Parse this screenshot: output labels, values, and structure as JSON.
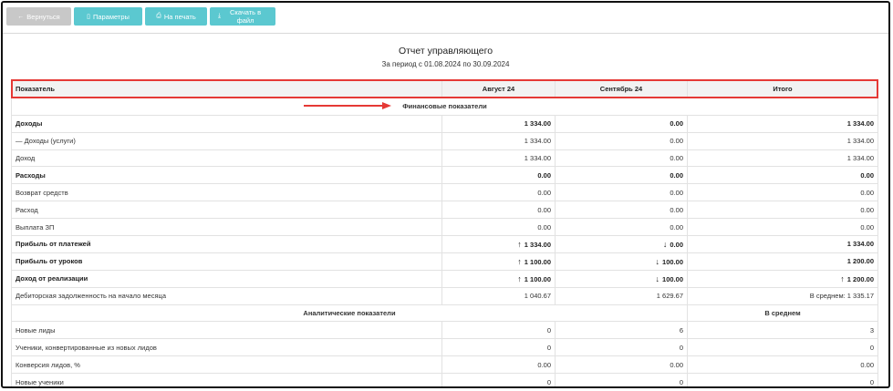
{
  "toolbar": {
    "back_label": "Вернуться",
    "params_label": "Параметры",
    "print_label": "На печать",
    "download_label": "Скачать в файл"
  },
  "report": {
    "title": "Отчет управляющего",
    "period": "За период с 01.08.2024 по 30.09.2024"
  },
  "table": {
    "headers": [
      "Показатель",
      "Август 24",
      "Сентябрь 24",
      "Итого"
    ],
    "sections": [
      {
        "title": "Финансовые показатели"
      },
      {
        "title": "Аналитические показатели",
        "side_title": "В среднем"
      }
    ],
    "financial_rows": [
      {
        "label": "Доходы",
        "bold": true,
        "aug": "1 334.00",
        "sep": "0.00",
        "total": "1 334.00"
      },
      {
        "label": "— Доходы (услуги)",
        "bold": false,
        "aug": "1 334.00",
        "sep": "0.00",
        "total": "1 334.00"
      },
      {
        "label": "Доход",
        "bold": false,
        "aug": "1 334.00",
        "sep": "0.00",
        "total": "1 334.00"
      },
      {
        "label": "Расходы",
        "bold": true,
        "aug": "0.00",
        "sep": "0.00",
        "total": "0.00"
      },
      {
        "label": "Возврат средств",
        "bold": false,
        "aug": "0.00",
        "sep": "0.00",
        "total": "0.00"
      },
      {
        "label": "Расход",
        "bold": false,
        "aug": "0.00",
        "sep": "0.00",
        "total": "0.00"
      },
      {
        "label": "Выплата ЗП",
        "bold": false,
        "aug": "0.00",
        "sep": "0.00",
        "total": "0.00"
      },
      {
        "label": "Прибыль от платежей",
        "bold": true,
        "aug": "1 334.00",
        "aug_trend": "up",
        "sep": "0.00",
        "sep_trend": "down",
        "total": "1 334.00"
      },
      {
        "label": "Прибыль от уроков",
        "bold": true,
        "aug": "1 100.00",
        "aug_trend": "up",
        "sep": "100.00",
        "sep_trend": "down",
        "total": "1 200.00"
      },
      {
        "label": "Доход от реализации",
        "bold": true,
        "aug": "1 100.00",
        "aug_trend": "up",
        "sep": "100.00",
        "sep_trend": "down",
        "total": "1 200.00",
        "total_trend": "up"
      },
      {
        "label": "Дебиторская задолженность на начало месяца",
        "bold": false,
        "aug": "1 040.67",
        "sep": "1 629.67",
        "total": "В среднем: 1 335.17"
      }
    ],
    "analytic_rows": [
      {
        "label": "Новые лиды",
        "aug": "0",
        "sep": "6",
        "total": "3"
      },
      {
        "label": "Ученики, конвертированные из новых лидов",
        "aug": "0",
        "sep": "0",
        "total": "0"
      },
      {
        "label": "Конверсия лидов, %",
        "aug": "0.00",
        "sep": "0.00",
        "total": "0.00"
      },
      {
        "label": "Новые ученики",
        "aug": "0",
        "sep": "0",
        "total": "0"
      }
    ]
  },
  "icons": {
    "up_arrow": "↑",
    "down_arrow": "↓"
  },
  "colors": {
    "accent_teal": "#5bc8d0",
    "back_button": "#c8c8c8",
    "highlight_red": "#e53935",
    "trend_up": "#3a8ee6",
    "trend_down": "#e0463d"
  }
}
